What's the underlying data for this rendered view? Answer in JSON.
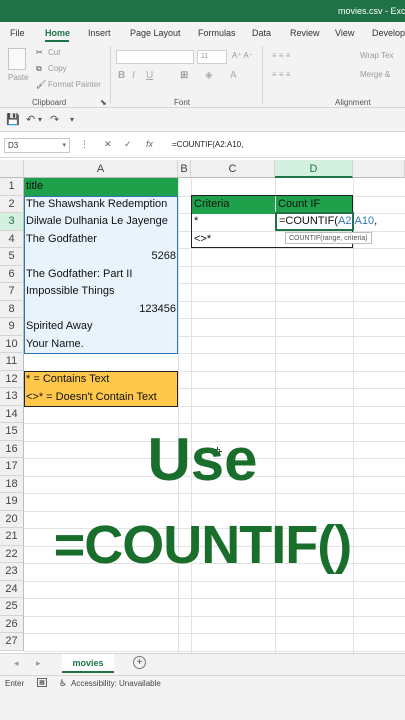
{
  "window": {
    "title": "movies.csv - Exce"
  },
  "menu": {
    "tabs": [
      "File",
      "Home",
      "Insert",
      "Page Layout",
      "Formulas",
      "Data",
      "Review",
      "View",
      "Develop"
    ],
    "active": "Home"
  },
  "ribbon": {
    "cut": "Cut",
    "copy": "Copy",
    "format_painter": "Format Painter",
    "paste": "Paste",
    "clipboard": "Clipboard",
    "font": "Font",
    "alignment": "Alignment",
    "wrap_text": "Wrap Tex",
    "merge": "Merge &",
    "font_size": "11"
  },
  "formula_bar": {
    "name_box": "D3",
    "fx": "fx",
    "formula": "=COUNTIF(A2:A10,"
  },
  "columns": [
    "A",
    "B",
    "C",
    "D"
  ],
  "rows": [
    "1",
    "2",
    "3",
    "4",
    "5",
    "6",
    "7",
    "8",
    "9",
    "10",
    "11",
    "12",
    "13",
    "14",
    "15",
    "16",
    "17",
    "18",
    "19",
    "20",
    "21",
    "22",
    "23",
    "24",
    "25",
    "26",
    "27"
  ],
  "cells": {
    "a1": "title",
    "a2": "The Shawshank Redemption",
    "a3": "Dilwale Dulhania Le Jayenge",
    "a4": "The Godfather",
    "a5": "5268",
    "a6": "The Godfather: Part II",
    "a7": "Impossible Things",
    "a8": "123456",
    "a9": "Spirited Away",
    "a10": "Your Name.",
    "a12": "* = Contains Text",
    "a13": "<>* = Doesn't Contain Text",
    "c2": "Criteria",
    "d2": "Count IF",
    "c3": "*",
    "d3_prefix": "=COUNTIF(",
    "d3_ref": "A2:A10",
    "d3_suffix": ",",
    "c4": "<>*"
  },
  "tooltip": "COUNTIF(range, criteria)",
  "overlay": {
    "line1": "Use",
    "line2": "=COUNTIF()"
  },
  "sheet": {
    "tab": "movies"
  },
  "status": {
    "mode": "Enter",
    "accessibility": "Accessibility: Unavailable"
  },
  "colors": {
    "accent": "#1f7245",
    "header_green": "#1fa04a",
    "note_yellow": "#ffc84a",
    "overlay_text": "#1a6e2c"
  }
}
